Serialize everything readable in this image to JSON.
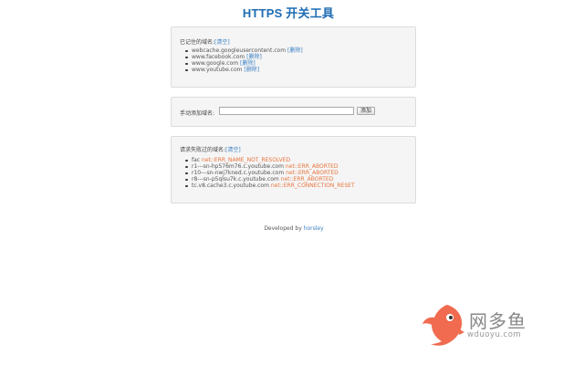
{
  "title": "HTTPS 开关工具",
  "saved": {
    "label": "已记住的域名:",
    "clear": "[清空]",
    "items": [
      {
        "domain": "webcache.googleusercontent.com",
        "action": "[删除]"
      },
      {
        "domain": "www.facebook.com",
        "action": "[删除]"
      },
      {
        "domain": "www.google.com",
        "action": "[删除]"
      },
      {
        "domain": "www.youtube.com",
        "action": "[删除]"
      }
    ]
  },
  "manual": {
    "label": "手动添加域名:",
    "input_value": "",
    "button": "添加"
  },
  "failed": {
    "label": "请求失败过的域名:",
    "clear": "[清空]",
    "items": [
      {
        "domain": "fac",
        "error": "net::ERR_NAME_NOT_RESOLVED"
      },
      {
        "domain": "r1---sn-hp576m76.c.youtube.com",
        "error": "net::ERR_ABORTED"
      },
      {
        "domain": "r10---sn-nwj7kned.c.youtube.com",
        "error": "net::ERR_ABORTED"
      },
      {
        "domain": "r8---sn-p5qlsu7k.c.youtube.com",
        "error": "net::ERR_ABORTED"
      },
      {
        "domain": "tc.v8.cache3.c.youtube.com",
        "error": "net::ERR_CONNECTION_RESET"
      }
    ]
  },
  "footer": {
    "prefix": "Developed by",
    "author": "horsley"
  },
  "watermark": {
    "name": "网多鱼",
    "url": "wduoyu.com",
    "color": "#f06b4f"
  }
}
